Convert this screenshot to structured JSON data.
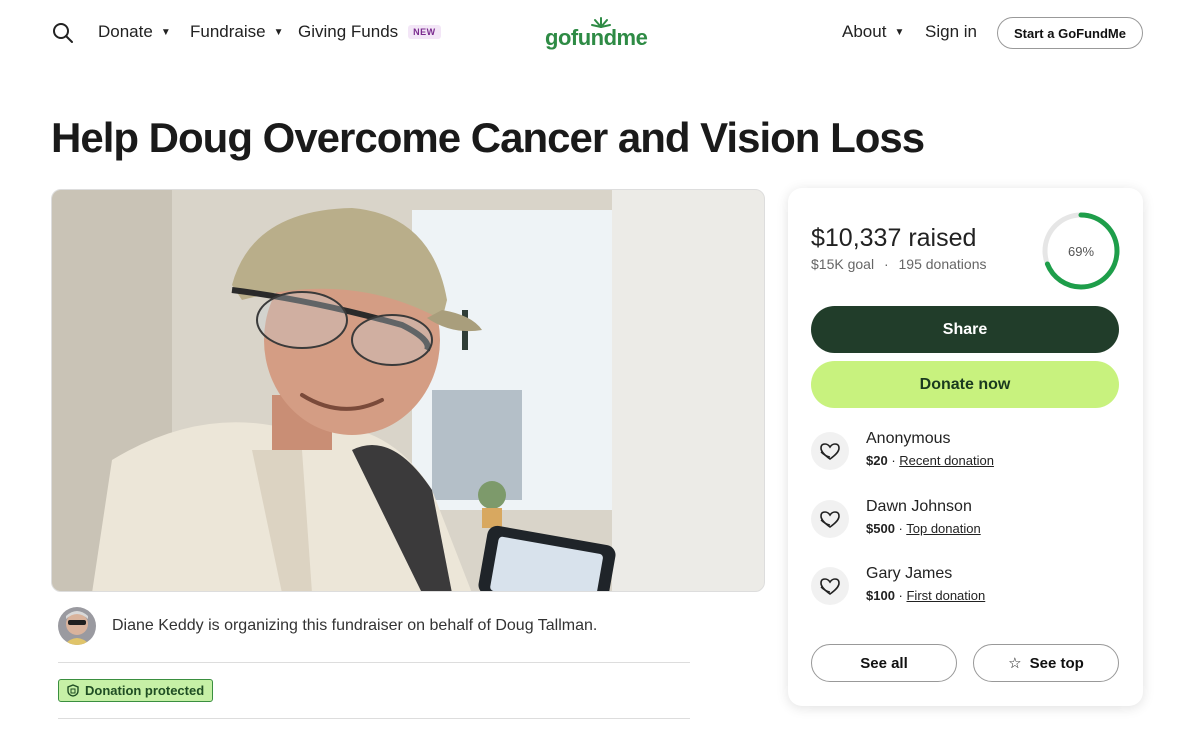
{
  "header": {
    "nav": [
      {
        "label": "Donate"
      },
      {
        "label": "Fundraise"
      },
      {
        "label": "Giving Funds",
        "badge": "NEW"
      }
    ],
    "logo_text": "gofundme",
    "about_label": "About",
    "signin_label": "Sign in",
    "start_label": "Start a GoFundMe"
  },
  "title": "Help Doug Overcome Cancer and Vision Loss",
  "organizer": {
    "text": "Diane Keddy is organizing this fundraiser on behalf of Doug Tallman."
  },
  "protected_label": "Donation protected",
  "card": {
    "raised": "$10,337 raised",
    "goal": "$15K goal",
    "separator": "·",
    "donations": "195 donations",
    "progress_label": "69%",
    "progress_fraction": 0.69,
    "share_label": "Share",
    "donate_label": "Donate now",
    "donors": [
      {
        "name": "Anonymous",
        "amount": "$20",
        "type": "Recent donation"
      },
      {
        "name": "Dawn Johnson",
        "amount": "$500",
        "type": "Top donation"
      },
      {
        "name": "Gary James",
        "amount": "$100",
        "type": "First donation"
      }
    ],
    "see_all_label": "See all",
    "see_top_label": "See top"
  },
  "colors": {
    "brand_green": "#2e8b45",
    "share_bg": "#213d2a",
    "donate_bg": "#c8f27e",
    "ring": "#1e9e4a"
  },
  "icons": [
    "search-icon",
    "caret-down-icon",
    "heart-hands-icon",
    "star-icon",
    "shield-icon"
  ]
}
